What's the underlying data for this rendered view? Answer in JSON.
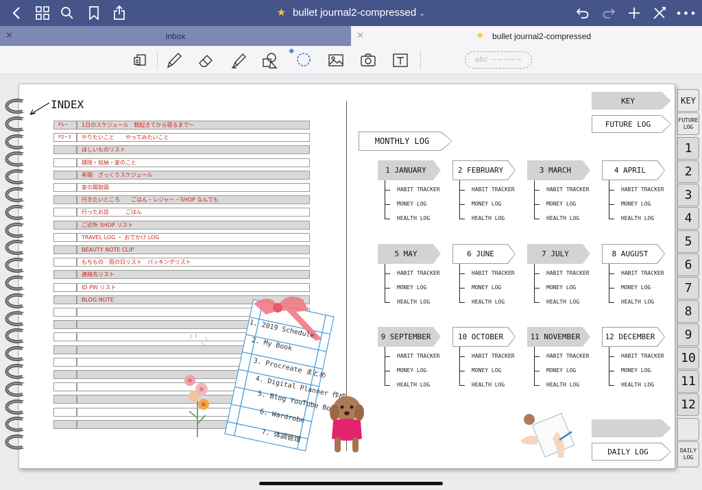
{
  "app": {
    "document_title": "bullet journal2-compressed",
    "tabs": [
      {
        "label": "inbox",
        "active": false
      },
      {
        "label": "bullet journal2-compressed",
        "active": true
      }
    ],
    "colors": {
      "nav_bar": "#45558a",
      "inactive_tab": "#7b89b3",
      "star": "#f6c744",
      "ink_red": "#c8281c"
    }
  },
  "nav_icons": [
    "back-chevron-icon",
    "grid-icon",
    "search-icon",
    "bookmark-icon",
    "share-icon",
    "undo-icon",
    "redo-icon",
    "add-icon",
    "close-pen-icon",
    "more-icon"
  ],
  "toolbar": {
    "tools": [
      "page-mode-icon",
      "pen-icon",
      "eraser-icon",
      "highlighter-icon",
      "shapes-icon",
      "lasso-icon",
      "image-icon",
      "camera-icon",
      "text-icon"
    ],
    "sticker_placeholder": "abc ~~~~~"
  },
  "journal": {
    "index_label": "INDEX",
    "index_rows": [
      {
        "num": "P1~",
        "text": "1日のスケジュール　朝起きてから寝るまで〜"
      },
      {
        "num": "P2~3",
        "text": "やりたいこと　　やってみたいこと"
      },
      {
        "num": "",
        "text": "ほしいものリスト"
      },
      {
        "num": "",
        "text": "掃除・収納・家のこと"
      },
      {
        "num": "",
        "text": "年間　ざっくりスケジュール"
      },
      {
        "num": "",
        "text": "家の間取図"
      },
      {
        "num": "",
        "text": "行きたいところ　　ごはん・レジャー・SHOP なんでも"
      },
      {
        "num": "",
        "text": "行ったお店　　　ごはん"
      },
      {
        "num": "",
        "text": "ご近所 SHOP リスト"
      },
      {
        "num": "",
        "text": "TRAVEL LOG ・ おでかけ LOG"
      },
      {
        "num": "",
        "text": "BEAUTY NOTE  CLIP"
      },
      {
        "num": "",
        "text": "もちもの　雨の日リスト　パッキングリスト"
      },
      {
        "num": "",
        "text": "連絡先リスト"
      },
      {
        "num": "",
        "text": "ID  PW リスト"
      },
      {
        "num": "",
        "text": "BLOG  NOTE"
      },
      {
        "num": "",
        "text": ""
      },
      {
        "num": "",
        "text": ""
      },
      {
        "num": "",
        "text": ""
      },
      {
        "num": "",
        "text": ""
      },
      {
        "num": "",
        "text": ""
      },
      {
        "num": "",
        "text": ""
      },
      {
        "num": "",
        "text": ""
      },
      {
        "num": "",
        "text": ""
      },
      {
        "num": "",
        "text": ""
      },
      {
        "num": "",
        "text": ""
      }
    ],
    "sticky_list": [
      "1. 2019 Schedule",
      "2. My Book",
      "3. Procreate まとめ",
      "4. Digital Planner 作成",
      "5. Blog YouTube Booth",
      "6. Wardrobe",
      "7. 体調管理"
    ],
    "key_label": "KEY",
    "future_log_label": "FUTURE LOG",
    "monthly_log_label": "MONTHLY LOG",
    "daily_log_label": "DAILY LOG",
    "months": [
      {
        "label": "1 JANUARY",
        "shaded": true
      },
      {
        "label": "2 FEBRUARY",
        "shaded": false
      },
      {
        "label": "3 MARCH",
        "shaded": true
      },
      {
        "label": "4 APRIL",
        "shaded": false
      },
      {
        "label": "5 MAY",
        "shaded": true
      },
      {
        "label": "6 JUNE",
        "shaded": false
      },
      {
        "label": "7 JULY",
        "shaded": true
      },
      {
        "label": "8 AUGUST",
        "shaded": false
      },
      {
        "label": "9 SEPTEMBER",
        "shaded": true
      },
      {
        "label": "10 OCTOBER",
        "shaded": false
      },
      {
        "label": "11 NOVEMBER",
        "shaded": true
      },
      {
        "label": "12 DECEMBER",
        "shaded": false
      }
    ],
    "month_sublinks": [
      "HABIT TRACKER",
      "MONEY LOG",
      "HEALTH LOG"
    ],
    "side_tabs": [
      "KEY",
      "FUTURE LOG",
      "1",
      "2",
      "3",
      "4",
      "5",
      "6",
      "7",
      "8",
      "9",
      "10",
      "11",
      "12",
      "",
      "DAILY LOG"
    ]
  }
}
